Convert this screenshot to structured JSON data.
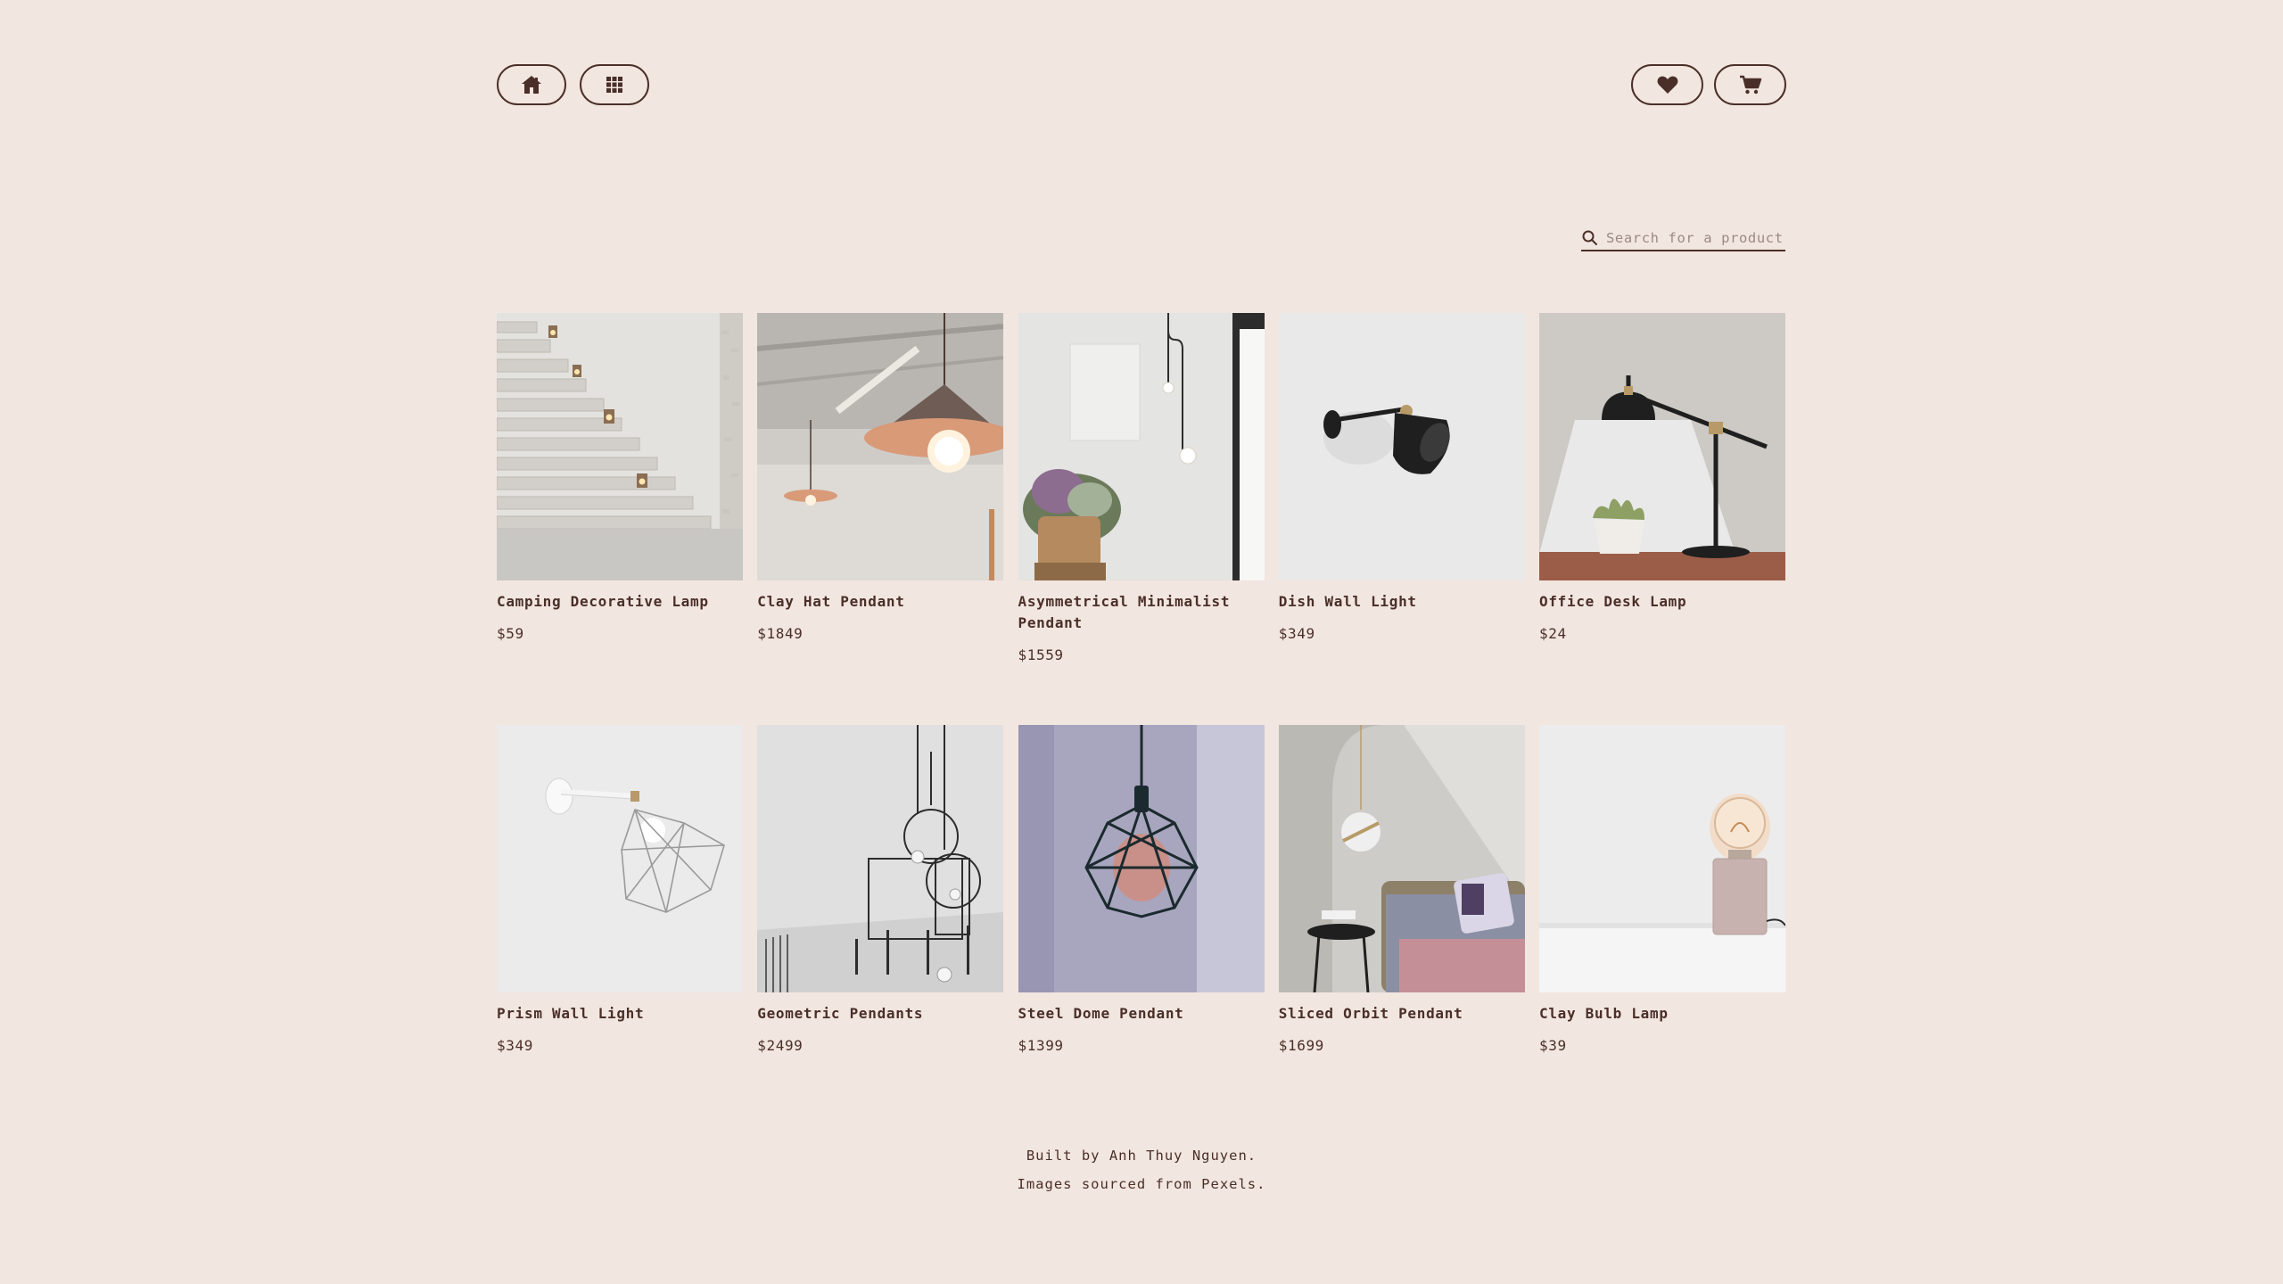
{
  "nav": {
    "home_icon": "home-icon",
    "grid_icon": "grid-icon",
    "wishlist_icon": "heart-icon",
    "cart_icon": "cart-icon"
  },
  "search": {
    "placeholder": "Search for a product",
    "icon": "search-icon"
  },
  "products": [
    {
      "name": "Camping Decorative Lamp",
      "price": "$59"
    },
    {
      "name": "Clay Hat Pendant",
      "price": "$1849"
    },
    {
      "name": "Asymmetrical Minimalist Pendant",
      "price": "$1559"
    },
    {
      "name": "Dish Wall Light",
      "price": "$349"
    },
    {
      "name": "Office Desk Lamp",
      "price": "$24"
    },
    {
      "name": "Prism Wall Light",
      "price": "$349"
    },
    {
      "name": "Geometric Pendants",
      "price": "$2499"
    },
    {
      "name": "Steel Dome Pendant",
      "price": "$1399"
    },
    {
      "name": "Sliced Orbit Pendant",
      "price": "$1699"
    },
    {
      "name": "Clay Bulb Lamp",
      "price": "$39"
    }
  ],
  "footer": {
    "line1": "Built by Anh Thuy Nguyen.",
    "line2": "Images sourced from Pexels."
  },
  "colors": {
    "background": "#f2e6e0",
    "text": "#4a2f28",
    "placeholder": "#9b8984"
  }
}
